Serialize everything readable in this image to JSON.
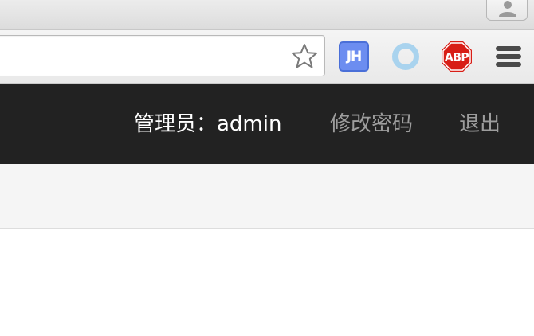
{
  "browser": {
    "extensions": [
      {
        "name": "JH",
        "label": "JH",
        "icon": "jh-extension-icon",
        "color": "#6c8df0"
      },
      {
        "name": "ring",
        "icon": "ring-extension-icon",
        "color": "#9fd0ee"
      },
      {
        "name": "Adblock Plus",
        "label": "ABP",
        "icon": "adblock-plus-icon",
        "color": "#d81e16"
      }
    ],
    "bookmark_icon": "star-icon",
    "menu_icon": "hamburger-menu-icon",
    "profile_icon": "user-profile-icon"
  },
  "navbar": {
    "user_label": "管理员：admin",
    "change_password": "修改密码",
    "logout": "退出",
    "background": "#222222",
    "link_color": "#9d9d9d"
  }
}
